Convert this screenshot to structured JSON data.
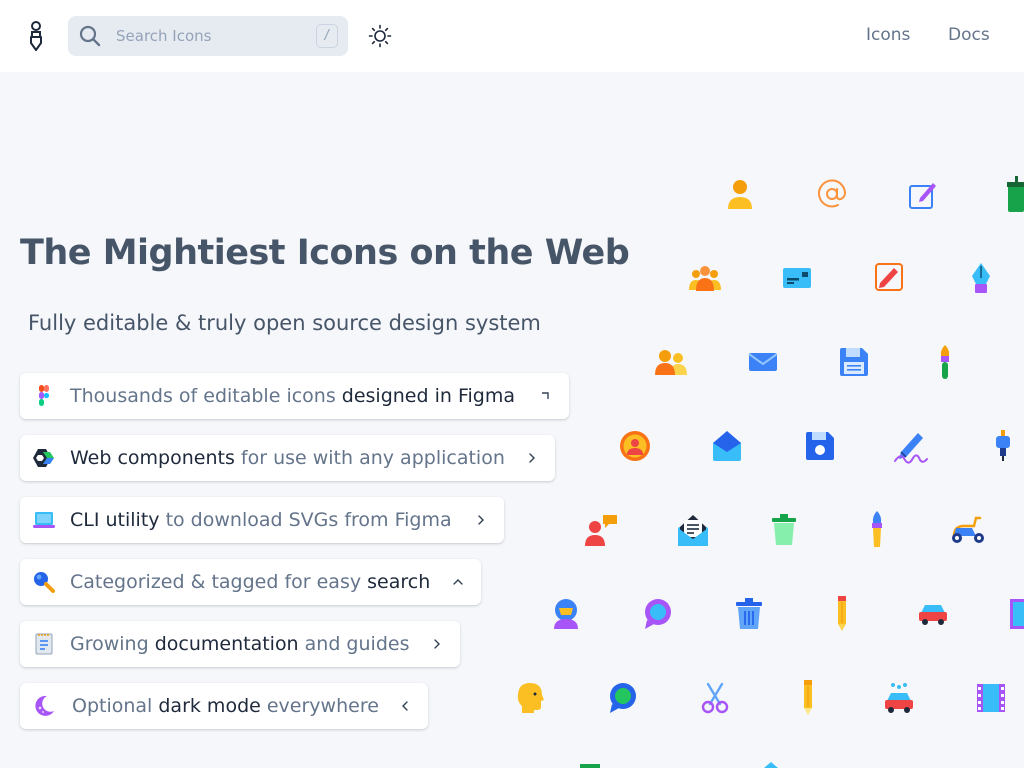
{
  "header": {
    "search_placeholder": "Search Icons",
    "search_shortcut": "/",
    "nav": [
      {
        "label": "Icons"
      },
      {
        "label": "Docs"
      }
    ]
  },
  "hero": {
    "title": "The Mightiest Icons on the Web",
    "subtitle": "Fully editable & truly open source design system"
  },
  "features": [
    {
      "icon": "figma-icon",
      "parts": [
        "Thousands of editable icons ",
        "designed in Figma"
      ],
      "arrow": "corner"
    },
    {
      "icon": "web-components-icon",
      "parts": [
        "Web components",
        " for use with any application"
      ],
      "arrow": "right"
    },
    {
      "icon": "laptop-icon",
      "parts": [
        "CLI utility",
        " to download SVGs from Figma"
      ],
      "arrow": "right"
    },
    {
      "icon": "search-icon",
      "parts": [
        "Categorized & tagged for easy ",
        "search"
      ],
      "arrow": "up"
    },
    {
      "icon": "document-icon",
      "parts": [
        "Growing ",
        "documentation",
        " and guides"
      ],
      "arrow": "right"
    },
    {
      "icon": "moon-icon",
      "parts": [
        "Optional ",
        "dark mode",
        " everywhere"
      ],
      "arrow": "left"
    }
  ],
  "colors": {
    "accent_orange": "#f59e0b",
    "accent_blue": "#3b82f6",
    "accent_purple": "#8b5cf6",
    "accent_green": "#22c55e",
    "accent_red": "#ef4444",
    "accent_teal": "#38bdf8"
  },
  "showcase_icons": [
    "user-icon",
    "at-sign-icon",
    "edit-icon",
    "cup-icon",
    "users-group-icon",
    "id-card-icon",
    "pencil-square-icon",
    "pen-nib-icon",
    "users-icon",
    "mail-icon",
    "floppy-disk-icon",
    "paint-brush-icon",
    "user-circle-icon",
    "mail-open-icon",
    "save-icon",
    "signature-icon",
    "hand-mixer-icon",
    "user-chat-icon",
    "mail-letter-icon",
    "trash-can-icon",
    "brush-icon",
    "scooter-icon",
    "astronaut-icon",
    "chat-bubble-icon",
    "trash-icon",
    "pencil-icon",
    "car-icon",
    "film-icon",
    "head-profile-icon",
    "comment-icon",
    "scissors-icon",
    "pencil-yellow-icon",
    "car-wash-icon",
    "film-strip-icon"
  ]
}
